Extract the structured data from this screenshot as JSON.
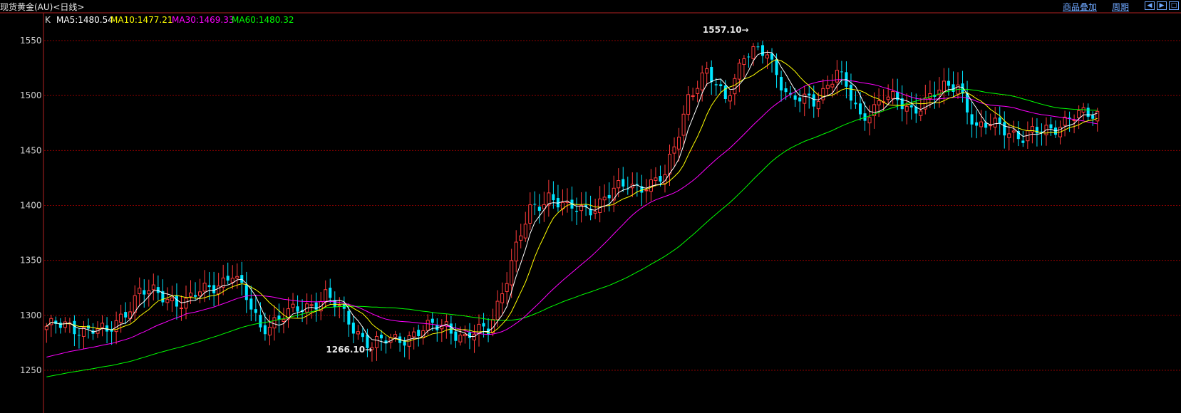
{
  "header": {
    "title": "现货黄金(AU)<日线>",
    "menu_overlay": "商品叠加",
    "menu_period": "周期",
    "nav_left_icon": "arrow-left-icon",
    "nav_right_icon": "arrow-right-icon",
    "nav_max_icon": "maximize-icon"
  },
  "legend": {
    "k": "K",
    "ma5": "MA5:1480.54",
    "ma10": "MA10:1477.21",
    "ma30": "MA30:1469.33",
    "ma60": "MA60:1480.32"
  },
  "colors": {
    "background": "#000000",
    "grid": "#8b0000",
    "axis": "#b22222",
    "up": "#ff3b3b",
    "down": "#00e5ff",
    "ma5": "#ffffff",
    "ma10": "#ffff00",
    "ma30": "#ff00ff",
    "ma60": "#00ff00"
  },
  "chart_data": {
    "type": "candlestick",
    "ylim": [
      1240,
      1575
    ],
    "yticks": [
      1250,
      1300,
      1350,
      1400,
      1450,
      1500,
      1550
    ],
    "grid": true,
    "annotations": [
      {
        "label": "1557.10",
        "index": 150,
        "value": 1557.1,
        "side": "right"
      },
      {
        "label": "1266.10",
        "index": 69,
        "value": 1266.1,
        "side": "right"
      }
    ],
    "anchors": [
      [
        0,
        1290
      ],
      [
        10,
        1288
      ],
      [
        13,
        1282
      ],
      [
        20,
        1322
      ],
      [
        30,
        1312
      ],
      [
        40,
        1338
      ],
      [
        46,
        1290
      ],
      [
        52,
        1300
      ],
      [
        60,
        1318
      ],
      [
        66,
        1290
      ],
      [
        70,
        1272
      ],
      [
        78,
        1282
      ],
      [
        86,
        1292
      ],
      [
        90,
        1278
      ],
      [
        95,
        1288
      ],
      [
        104,
        1395
      ],
      [
        108,
        1410
      ],
      [
        112,
        1395
      ],
      [
        118,
        1400
      ],
      [
        125,
        1420
      ],
      [
        130,
        1418
      ],
      [
        133,
        1425
      ],
      [
        138,
        1500
      ],
      [
        142,
        1518
      ],
      [
        146,
        1500
      ],
      [
        150,
        1535
      ],
      [
        155,
        1540
      ],
      [
        160,
        1495
      ],
      [
        165,
        1495
      ],
      [
        170,
        1522
      ],
      [
        175,
        1480
      ],
      [
        180,
        1498
      ],
      [
        186,
        1488
      ],
      [
        193,
        1505
      ],
      [
        196,
        1512
      ],
      [
        200,
        1468
      ],
      [
        205,
        1475
      ],
      [
        210,
        1460
      ],
      [
        215,
        1470
      ],
      [
        220,
        1478
      ],
      [
        226,
        1485
      ]
    ],
    "count": 227,
    "ma_last": {
      "ma5": 1480.54,
      "ma10": 1477.21,
      "ma30": 1469.33,
      "ma60": 1480.32
    }
  }
}
